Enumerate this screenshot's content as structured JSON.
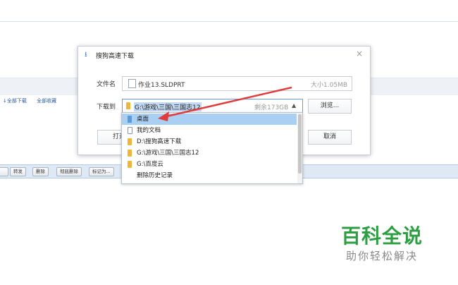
{
  "background": {
    "links": [
      "全部下载",
      "全部收藏"
    ],
    "toolbar_buttons": [
      "转发",
      "删除",
      "彻底删除",
      "标记为..."
    ]
  },
  "dialog": {
    "title": "搜狗高速下载",
    "close_label": "×",
    "filename_label": "文件名",
    "filename_value": "作业13.SLDPRT",
    "size_text": "大小1.05MB",
    "saveto_label": "下载到",
    "path_value": "G:\\游戏\\三国\\三国志12",
    "free_space_text": "剩余173GB",
    "browse_button": "浏览...",
    "open_button": "打开",
    "cancel_button": "取消"
  },
  "dropdown": {
    "items": [
      {
        "label": "桌面",
        "icon": "desktop-icon",
        "selected": true
      },
      {
        "label": "我的文档",
        "icon": "documents-icon",
        "selected": false
      },
      {
        "label": "D:\\搜狗高速下载",
        "icon": "folder-icon",
        "selected": false
      },
      {
        "label": "G:\\游戏\\三国\\三国志12",
        "icon": "folder-icon",
        "selected": false
      },
      {
        "label": "G:\\百度云",
        "icon": "folder-icon",
        "selected": false
      },
      {
        "label": "删除历史记录",
        "icon": "",
        "selected": false
      }
    ]
  },
  "watermark": {
    "title": "百科全说",
    "subtitle": "助你轻松解决"
  },
  "colors": {
    "arrow": "#e03c3c",
    "accent": "#2f7bd8",
    "watermark": "#2e9e43"
  }
}
